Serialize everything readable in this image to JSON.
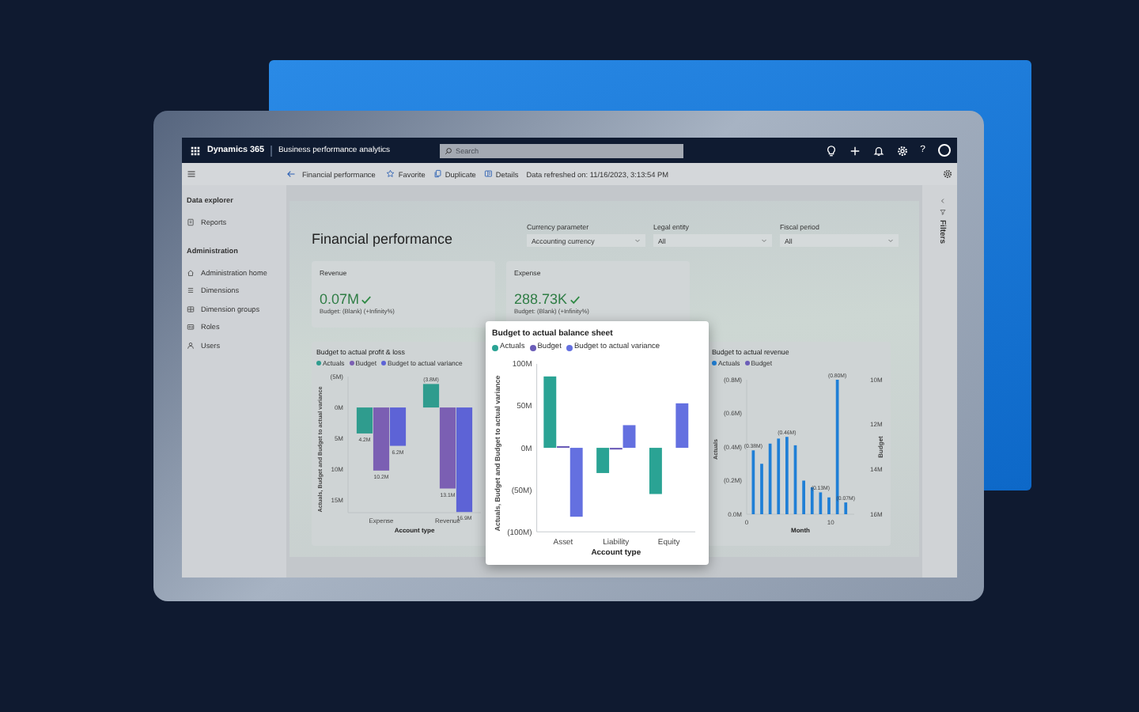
{
  "header": {
    "app": "Dynamics 365",
    "area": "Business performance analytics",
    "search": {
      "placeholder": "Search"
    },
    "help": "?"
  },
  "command_bar": {
    "page": "Financial performance",
    "actions": [
      {
        "label": "Favorite"
      },
      {
        "label": "Duplicate"
      },
      {
        "label": "Details"
      }
    ],
    "refreshed": "Data refreshed on: 11/16/2023, 3:13:54 PM"
  },
  "sidebar": {
    "sections": [
      {
        "title": "Data explorer",
        "items": [
          {
            "label": "Reports"
          }
        ]
      },
      {
        "title": "Administration",
        "items": [
          {
            "label": "Administration home"
          },
          {
            "label": "Dimensions"
          },
          {
            "label": "Dimension groups"
          },
          {
            "label": "Roles"
          },
          {
            "label": "Users"
          }
        ]
      }
    ]
  },
  "page": {
    "title": "Financial performance",
    "filters": [
      {
        "label": "Currency parameter",
        "value": "Accounting currency"
      },
      {
        "label": "Legal entity",
        "value": "All"
      },
      {
        "label": "Fiscal period",
        "value": "All"
      }
    ],
    "kpis": [
      {
        "label": "Revenue",
        "value": "0.07M",
        "note": "Budget: (Blank) (+Infinity%)"
      },
      {
        "label": "Expense",
        "value": "288.73K",
        "note": "Budget: (Blank) (+Infinity%)"
      }
    ],
    "charts": [
      {
        "chart_data": {
          "type": "bar",
          "title": "Budget to actual profit & loss",
          "xlabel": "Account type",
          "ylabel": "Actuals, Budget and Budget to actual variance",
          "categories": [
            "Expense",
            "Revenue"
          ],
          "series": [
            {
              "name": "Actuals",
              "color": "#2f9c8e",
              "values": [
                4.2,
                -3.8
              ],
              "value_labels": [
                "4.2M",
                "(3.8M)"
              ]
            },
            {
              "name": "Budget",
              "color": "#7b5fb3",
              "values": [
                10.2,
                13.1
              ],
              "value_labels": [
                "10.2M",
                "13.1M"
              ]
            },
            {
              "name": "Budget to actual variance",
              "color": "#5d63d6",
              "values": [
                6.2,
                16.9
              ],
              "value_labels": [
                "6.2M",
                "16.9M"
              ]
            }
          ],
          "legend": "top",
          "ylim": [
            17,
            -5
          ],
          "yticks": [
            {
              "value": -5,
              "label": "(5M)"
            },
            {
              "value": 0,
              "label": "0M"
            },
            {
              "value": 5,
              "label": "5M"
            },
            {
              "value": 10,
              "label": "10M"
            },
            {
              "value": 15,
              "label": "15M"
            }
          ]
        }
      },
      {
        "chart_data": {
          "type": "bar",
          "title": "Budget to actual revenue",
          "xlabel": "Month",
          "ylabel": "Actuals",
          "y2label": "Budget",
          "legend": "top",
          "x": [
            1,
            2,
            3,
            4,
            5,
            6,
            7,
            8,
            9,
            10,
            11,
            12
          ],
          "xlim": [
            0,
            12.8
          ],
          "xticks": [
            0,
            10
          ],
          "series": [
            {
              "name": "Actuals",
              "color": "#1f7fd6",
              "values": [
                -0.38,
                -0.3,
                -0.42,
                -0.45,
                -0.46,
                -0.41,
                -0.2,
                -0.16,
                -0.13,
                -0.1,
                -0.8,
                -0.07
              ],
              "value_labels": [
                "(0.38M)",
                null,
                null,
                null,
                "(0.46M)",
                null,
                null,
                null,
                "(0.13M)",
                null,
                "(0.80M)",
                "(0.07M)"
              ]
            },
            {
              "name": "Budget",
              "color": "#6b5db8",
              "values": [
                null,
                null,
                null,
                null,
                null,
                null,
                null,
                null,
                null,
                null,
                null,
                null
              ]
            }
          ],
          "stacked": false,
          "ylim": [
            0,
            -0.8
          ],
          "yticks": [
            {
              "value": 0,
              "label": "0.0M"
            },
            {
              "value": -0.2,
              "label": "(0.2M)"
            },
            {
              "value": -0.4,
              "label": "(0.4M)"
            },
            {
              "value": -0.6,
              "label": "(0.6M)"
            },
            {
              "value": -0.8,
              "label": "(0.8M)"
            }
          ],
          "y2lim": [
            16,
            10
          ],
          "y2ticks": [
            {
              "value": 10,
              "label": "10M"
            },
            {
              "value": 12,
              "label": "12M"
            },
            {
              "value": 14,
              "label": "14M"
            },
            {
              "value": 16,
              "label": "16M"
            }
          ]
        }
      }
    ]
  },
  "popup": {
    "chart_data": {
      "type": "bar",
      "title": "Budget to actual balance sheet",
      "xlabel": "Account type",
      "ylabel": "Actuals, Budget and Budget to actual variance",
      "legend": "top",
      "categories": [
        "Asset",
        "Liability",
        "Equity"
      ],
      "series": [
        {
          "name": "Actuals",
          "color": "#2aa394",
          "values": [
            85,
            -30,
            -55
          ]
        },
        {
          "name": "Budget",
          "color": "#6b5db8",
          "values": [
            2,
            -2,
            null
          ]
        },
        {
          "name": "Budget to actual variance",
          "color": "#6470e0",
          "values": [
            -82,
            27,
            53
          ]
        }
      ],
      "ylim": [
        -100,
        100
      ],
      "yticks": [
        {
          "value": 100,
          "label": "100M"
        },
        {
          "value": 50,
          "label": "50M"
        },
        {
          "value": 0,
          "label": "0M"
        },
        {
          "value": -50,
          "label": "(50M)"
        },
        {
          "value": -100,
          "label": "(100M)"
        }
      ]
    }
  },
  "filter_pane": {
    "label": "Filters"
  }
}
